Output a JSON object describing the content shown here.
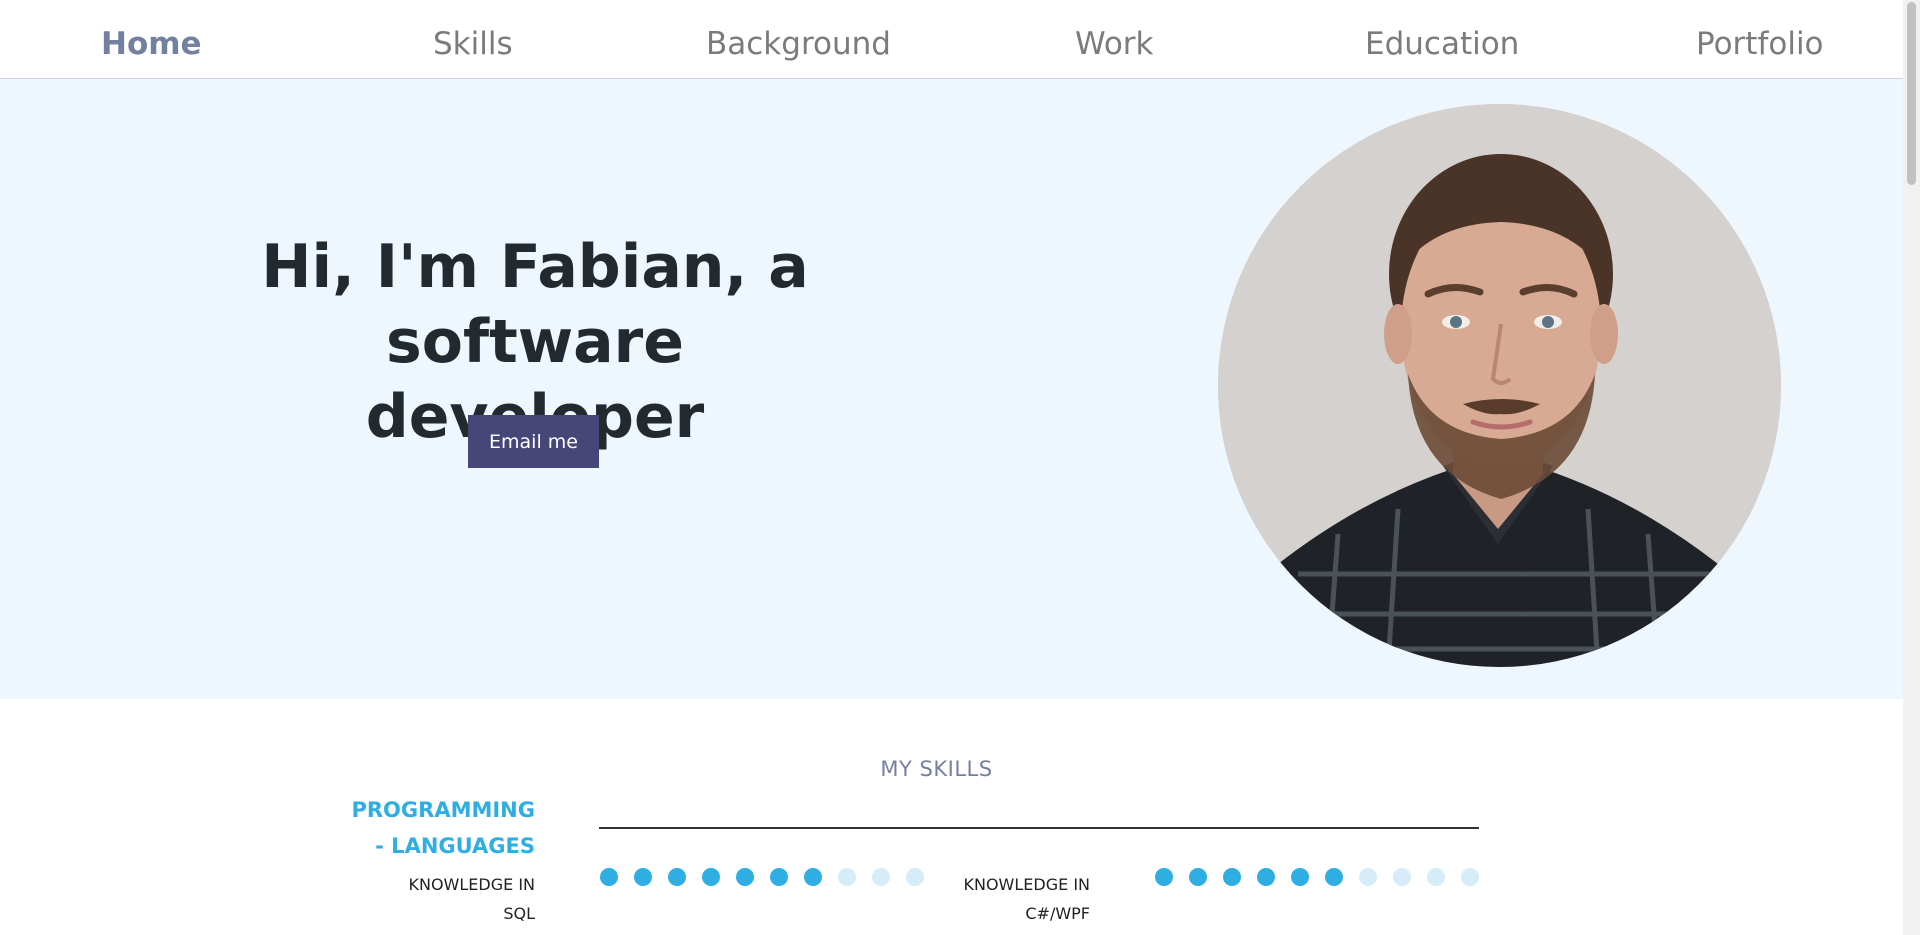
{
  "nav": {
    "items": [
      {
        "label": "Home"
      },
      {
        "label": "Skills"
      },
      {
        "label": "Background"
      },
      {
        "label": "Work"
      },
      {
        "label": "Education"
      },
      {
        "label": "Portfolio"
      }
    ]
  },
  "hero": {
    "title_line1": "Hi, I'm Fabian, a software",
    "title_line2": "developer",
    "cta_label": "Email me",
    "photo_alt": "avatar"
  },
  "skills": {
    "section_title": "MY SKILLS",
    "category_line1": "PROGRAMMING",
    "category_line2": "- LANGUAGES",
    "items": [
      {
        "label_line1": "KNOWLEDGE IN",
        "label_line2": "SQL",
        "level": 7,
        "max": 10
      },
      {
        "label_line1": "KNOWLEDGE IN",
        "label_line2": "C#/WPF",
        "level": 6,
        "max": 10
      }
    ]
  },
  "colors": {
    "accent": "#2eaee3",
    "accent_light": "#d6ecf8",
    "button": "#474678",
    "hero_bg": "#eef6fe",
    "nav_active": "#74809f"
  },
  "icons": {
    "scrollbar": "scrollbar-thumb"
  }
}
